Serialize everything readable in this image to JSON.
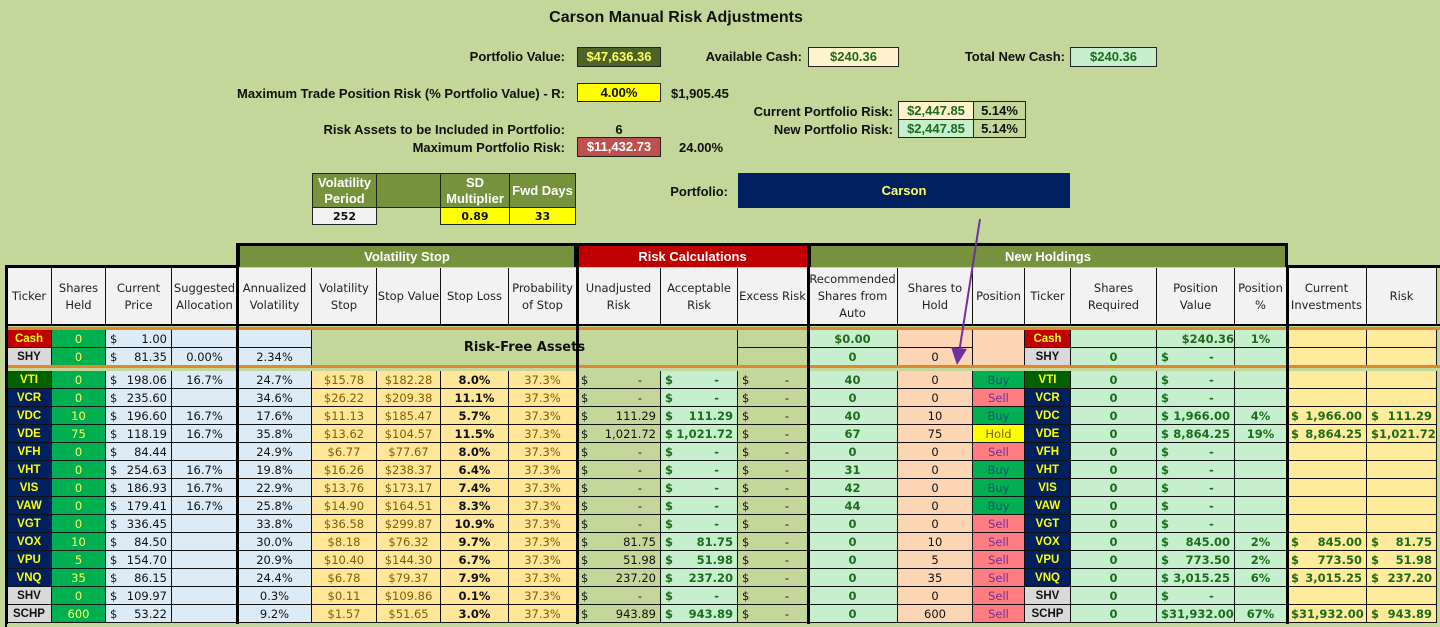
{
  "title": "Carson Manual Risk Adjustments",
  "summary": {
    "portfolio_value_label": "Portfolio Value:",
    "portfolio_value": "$47,636.36",
    "available_cash_label": "Available Cash:",
    "available_cash": "$240.36",
    "total_new_cash_label": "Total New Cash:",
    "total_new_cash": "$240.36",
    "max_trade_risk_label": "Maximum Trade Position Risk (% Portfolio Value) - R:",
    "max_trade_risk_pct": "4.00%",
    "max_trade_risk_amount": "$1,905.45",
    "current_risk_label": "Current Portfolio Risk:",
    "current_risk_amount": "$2,447.85",
    "current_risk_pct": "5.14%",
    "new_risk_label": "New Portfolio Risk:",
    "new_risk_amount": "$2,447.85",
    "new_risk_pct": "5.14%",
    "risk_assets_label": "Risk Assets to be Included in Portfolio:",
    "risk_assets_count": "6",
    "max_portfolio_risk_label": "Maximum Portfolio Risk:",
    "max_portfolio_risk_amount": "$11,432.73",
    "max_portfolio_risk_pct": "24.00%",
    "portfolio_label": "Portfolio:",
    "portfolio_name": "Carson"
  },
  "params": {
    "vol_period_label": "Volatility Period",
    "vol_period": "252",
    "sd_mult_label": "SD Multiplier",
    "sd_mult": "0.89",
    "fwd_days_label": "Fwd Days",
    "fwd_days": "33"
  },
  "sections": {
    "volatility_stop": "Volatility Stop",
    "risk_calculations": "Risk Calculations",
    "new_holdings": "New Holdings",
    "risk_free_assets": "Risk-Free Assets"
  },
  "columns": [
    "Ticker",
    "Shares Held",
    "Current Price",
    "Suggested Allocation",
    "Annualized Volatility",
    "Volatility Stop",
    "Stop Value",
    "Stop Loss",
    "Probability of Stop",
    "Unadjusted Risk",
    "Acceptable Risk",
    "Excess Risk",
    "Recommended Shares from Auto",
    "Shares to Hold",
    "Position",
    "Ticker",
    "Shares Required",
    "Position Value",
    "Position %",
    "Current Investments",
    "Risk"
  ],
  "risk_free_rows": [
    {
      "ticker": "Cash",
      "shares": "0",
      "price": "1.00",
      "alloc": "",
      "vol": "",
      "rec": "$0.00",
      "hold": "",
      "ticker2": "Cash",
      "req": "",
      "pos_val_plain": "$240.36",
      "pos_val": "",
      "pos_pct": "1%"
    },
    {
      "ticker": "SHY",
      "shares": "0",
      "price": "81.35",
      "alloc": "0.00%",
      "vol": "2.34%",
      "rec": "0",
      "hold": "0",
      "ticker2": "SHY",
      "req": "0",
      "pos_val_plain": "",
      "pos_val": "-",
      "pos_pct": ""
    }
  ],
  "rows": [
    {
      "ticker": "VTI",
      "shares": "0",
      "price": "198.06",
      "alloc": "16.7%",
      "vol": "24.7%",
      "vstop": "$15.78",
      "sval": "$182.28",
      "sloss": "8.0%",
      "prob": "37.3%",
      "unadj": "-",
      "accept": "-",
      "excess": "-",
      "rec": "40",
      "hold": "0",
      "position": "Buy",
      "req": "0",
      "pos_val": "-",
      "pos_pct": "",
      "cur_inv": "",
      "risk": ""
    },
    {
      "ticker": "VCR",
      "shares": "0",
      "price": "235.60",
      "alloc": "",
      "vol": "34.6%",
      "vstop": "$26.22",
      "sval": "$209.38",
      "sloss": "11.1%",
      "prob": "37.3%",
      "unadj": "-",
      "accept": "-",
      "excess": "-",
      "rec": "0",
      "hold": "0",
      "position": "Sell",
      "req": "0",
      "pos_val": "-",
      "pos_pct": "",
      "cur_inv": "",
      "risk": ""
    },
    {
      "ticker": "VDC",
      "shares": "10",
      "price": "196.60",
      "alloc": "16.7%",
      "vol": "17.6%",
      "vstop": "$11.13",
      "sval": "$185.47",
      "sloss": "5.7%",
      "prob": "37.3%",
      "unadj": "111.29",
      "accept": "111.29",
      "excess": "-",
      "rec": "40",
      "hold": "10",
      "position": "Buy",
      "req": "0",
      "pos_val": "1,966.00",
      "pos_pct": "4%",
      "cur_inv": "1,966.00",
      "risk": "111.29"
    },
    {
      "ticker": "VDE",
      "shares": "75",
      "price": "118.19",
      "alloc": "16.7%",
      "vol": "35.8%",
      "vstop": "$13.62",
      "sval": "$104.57",
      "sloss": "11.5%",
      "prob": "37.3%",
      "unadj": "1,021.72",
      "accept": "1,021.72",
      "excess": "-",
      "rec": "67",
      "hold": "75",
      "position": "Hold",
      "req": "0",
      "pos_val": "8,864.25",
      "pos_pct": "19%",
      "cur_inv": "8,864.25",
      "risk": "1,021.72"
    },
    {
      "ticker": "VFH",
      "shares": "0",
      "price": "84.44",
      "alloc": "",
      "vol": "24.9%",
      "vstop": "$6.77",
      "sval": "$77.67",
      "sloss": "8.0%",
      "prob": "37.3%",
      "unadj": "-",
      "accept": "-",
      "excess": "-",
      "rec": "0",
      "hold": "0",
      "position": "Sell",
      "req": "0",
      "pos_val": "-",
      "pos_pct": "",
      "cur_inv": "",
      "risk": ""
    },
    {
      "ticker": "VHT",
      "shares": "0",
      "price": "254.63",
      "alloc": "16.7%",
      "vol": "19.8%",
      "vstop": "$16.26",
      "sval": "$238.37",
      "sloss": "6.4%",
      "prob": "37.3%",
      "unadj": "-",
      "accept": "-",
      "excess": "-",
      "rec": "31",
      "hold": "0",
      "position": "Buy",
      "req": "0",
      "pos_val": "-",
      "pos_pct": "",
      "cur_inv": "",
      "risk": ""
    },
    {
      "ticker": "VIS",
      "shares": "0",
      "price": "186.93",
      "alloc": "16.7%",
      "vol": "22.9%",
      "vstop": "$13.76",
      "sval": "$173.17",
      "sloss": "7.4%",
      "prob": "37.3%",
      "unadj": "-",
      "accept": "-",
      "excess": "-",
      "rec": "42",
      "hold": "0",
      "position": "Buy",
      "req": "0",
      "pos_val": "-",
      "pos_pct": "",
      "cur_inv": "",
      "risk": ""
    },
    {
      "ticker": "VAW",
      "shares": "0",
      "price": "179.41",
      "alloc": "16.7%",
      "vol": "25.8%",
      "vstop": "$14.90",
      "sval": "$164.51",
      "sloss": "8.3%",
      "prob": "37.3%",
      "unadj": "-",
      "accept": "-",
      "excess": "-",
      "rec": "44",
      "hold": "0",
      "position": "Buy",
      "req": "0",
      "pos_val": "-",
      "pos_pct": "",
      "cur_inv": "",
      "risk": ""
    },
    {
      "ticker": "VGT",
      "shares": "0",
      "price": "336.45",
      "alloc": "",
      "vol": "33.8%",
      "vstop": "$36.58",
      "sval": "$299.87",
      "sloss": "10.9%",
      "prob": "37.3%",
      "unadj": "-",
      "accept": "-",
      "excess": "-",
      "rec": "0",
      "hold": "0",
      "position": "Sell",
      "req": "0",
      "pos_val": "-",
      "pos_pct": "",
      "cur_inv": "",
      "risk": ""
    },
    {
      "ticker": "VOX",
      "shares": "10",
      "price": "84.50",
      "alloc": "",
      "vol": "30.0%",
      "vstop": "$8.18",
      "sval": "$76.32",
      "sloss": "9.7%",
      "prob": "37.3%",
      "unadj": "81.75",
      "accept": "81.75",
      "excess": "-",
      "rec": "0",
      "hold": "10",
      "position": "Sell",
      "req": "0",
      "pos_val": "845.00",
      "pos_pct": "2%",
      "cur_inv": "845.00",
      "risk": "81.75"
    },
    {
      "ticker": "VPU",
      "shares": "5",
      "price": "154.70",
      "alloc": "",
      "vol": "20.9%",
      "vstop": "$10.40",
      "sval": "$144.30",
      "sloss": "6.7%",
      "prob": "37.3%",
      "unadj": "51.98",
      "accept": "51.98",
      "excess": "-",
      "rec": "0",
      "hold": "5",
      "position": "Sell",
      "req": "0",
      "pos_val": "773.50",
      "pos_pct": "2%",
      "cur_inv": "773.50",
      "risk": "51.98"
    },
    {
      "ticker": "VNQ",
      "shares": "35",
      "price": "86.15",
      "alloc": "",
      "vol": "24.4%",
      "vstop": "$6.78",
      "sval": "$79.37",
      "sloss": "7.9%",
      "prob": "37.3%",
      "unadj": "237.20",
      "accept": "237.20",
      "excess": "-",
      "rec": "0",
      "hold": "35",
      "position": "Sell",
      "req": "0",
      "pos_val": "3,015.25",
      "pos_pct": "6%",
      "cur_inv": "3,015.25",
      "risk": "237.20"
    },
    {
      "ticker": "SHV",
      "shares": "0",
      "price": "109.97",
      "alloc": "",
      "vol": "0.3%",
      "vstop": "$0.11",
      "sval": "$109.86",
      "sloss": "0.1%",
      "prob": "37.3%",
      "unadj": "-",
      "accept": "-",
      "excess": "-",
      "rec": "0",
      "hold": "0",
      "position": "Sell",
      "req": "0",
      "pos_val": "-",
      "pos_pct": "",
      "cur_inv": "",
      "risk": ""
    },
    {
      "ticker": "SCHP",
      "shares": "600",
      "price": "53.22",
      "alloc": "",
      "vol": "9.2%",
      "vstop": "$1.57",
      "sval": "$51.65",
      "sloss": "3.0%",
      "prob": "37.3%",
      "unadj": "943.89",
      "accept": "943.89",
      "excess": "-",
      "rec": "0",
      "hold": "600",
      "position": "Sell",
      "req": "0",
      "pos_val": "31,932.00",
      "pos_pct": "67%",
      "cur_inv": "31,932.00",
      "risk": "943.89"
    }
  ],
  "colors": {
    "background": "#c4d79b",
    "section_green": "#76923c",
    "section_red": "#c00000",
    "navy": "#002060",
    "buy": "#00b050",
    "sell": "#ff7c80",
    "hold": "#ffff00"
  }
}
